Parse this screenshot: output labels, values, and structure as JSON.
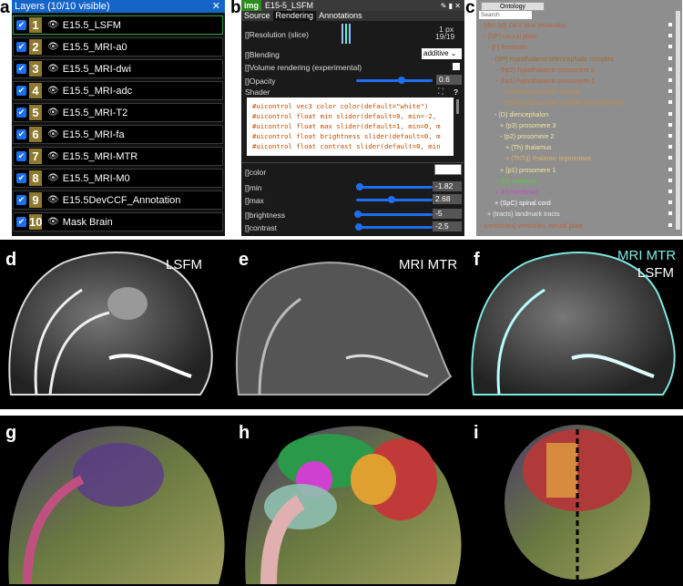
{
  "panel_letters": {
    "a": "a",
    "b": "b",
    "c": "c",
    "d": "d",
    "e": "e",
    "f": "f",
    "g": "g",
    "h": "h",
    "i": "i"
  },
  "layers": {
    "title": "Layers (10/10 visible)",
    "close": "✕",
    "checkmark": "✔",
    "eye": "👁",
    "items": [
      {
        "n": "1",
        "name": "E15.5_LSFM"
      },
      {
        "n": "2",
        "name": "E15.5_MRI-a0"
      },
      {
        "n": "3",
        "name": "E15.5_MRI-dwi"
      },
      {
        "n": "4",
        "name": "E15.5_MRI-adc"
      },
      {
        "n": "5",
        "name": "E15.5_MRI-T2"
      },
      {
        "n": "6",
        "name": "E15.5_MRI-fa"
      },
      {
        "n": "7",
        "name": "E15.5_MRI-MTR"
      },
      {
        "n": "8",
        "name": "E15.5_MRI-M0"
      },
      {
        "n": "9",
        "name": "E15.5DevCCF_Annotation"
      },
      {
        "n": "10",
        "name": "Mask Brain"
      }
    ]
  },
  "layer_panel": {
    "badge": "img",
    "title": "E15-5_LSFM",
    "tabs": [
      "Source",
      "Rendering",
      "Annotations"
    ],
    "resolution": "]Resolution (slice)",
    "res_val1": "1 px",
    "res_val2": "19/19",
    "blending": "]Blending",
    "blend_val": "additive",
    "volume": "]Volume rendering (experimental)",
    "opacity": "]Opacity",
    "opacity_val": "0.6",
    "shader": "Shader",
    "help": "?",
    "code": [
      "#uicontrol vec3 color color(default=\"white\")",
      "#uicontrol float min slider(default=0, min=-2,",
      "#uicontrol float max slider(default=1, min=0, m",
      "#uicontrol float brightness slider(default=0, m",
      "#uicontrol float contrast slider(default=0, min"
    ],
    "bracket": "[",
    "color": "]color",
    "min": "]min",
    "min_val": "-1.82",
    "max": "]max",
    "max_val": "2.68",
    "brightness": "]brightness",
    "brightness_val": "-5",
    "contrast": "]contrast",
    "contrast_val": "-2.5",
    "opacity_level": 0.6,
    "min_level": 0.05,
    "max_level": 0.47,
    "brightness_level": 0.02,
    "contrast_level": 0.03
  },
  "ontology": {
    "tab": "Ontology",
    "search": "Search",
    "items": [
      {
        "t": "- (dm-10) DEV Mus musculus",
        "c": "#b7643a"
      },
      {
        "t": "- (NP) neural plate",
        "c": "#b7643a"
      },
      {
        "t": "- (F) forebrain",
        "c": "#b7643a"
      },
      {
        "t": "- (SP) hypothalamo-telencephalic complex",
        "c": "#a06b2e"
      },
      {
        "t": "- (hp2) hypothalamic prosomere 2",
        "c": "#b7643a"
      },
      {
        "t": "- (hp1) hypothalamic prosomere 1",
        "c": "#b7643a"
      },
      {
        "t": "+ (Tel) telencephalic vesicle",
        "c": "#c68a4a"
      },
      {
        "t": "+ (PHy) peduncular (caudal) hypothalamus",
        "c": "#c68a4a"
      },
      {
        "t": "- (D) diencephalon",
        "c": "#f2e6a0"
      },
      {
        "t": "+ (p3) prosomere 3",
        "c": "#f2e6a0"
      },
      {
        "t": "- (p2) prosomere 2",
        "c": "#f2e6a0"
      },
      {
        "t": "+ (Th) thalamus",
        "c": "#f2e6a0"
      },
      {
        "t": "+ (ThTg) thalamic tegmentum",
        "c": "#d9b26a"
      },
      {
        "t": "+ (p1) prosomere 1",
        "c": "#f2e6a0"
      },
      {
        "t": "+ (M) midbrain",
        "c": "#5ec24a"
      },
      {
        "t": "+ (H) hindbrain",
        "c": "#c04fc0"
      },
      {
        "t": "+ (SpC) spinal cord",
        "c": "#ffffff"
      },
      {
        "t": "+ (tracts) landmark tracts",
        "c": "#e6e6e6"
      },
      {
        "t": "- (ventricles) ventricles, neural plate",
        "c": "#b7643a"
      }
    ]
  },
  "images": {
    "d_label": "LSFM",
    "e_label": "MRI MTR",
    "f_label1": "MRI MTR",
    "f_label2": "LSFM"
  },
  "colors": {
    "cyan": "#7fe8e0",
    "selected": "#2e9e3f",
    "slider": "#1d6ef0"
  }
}
